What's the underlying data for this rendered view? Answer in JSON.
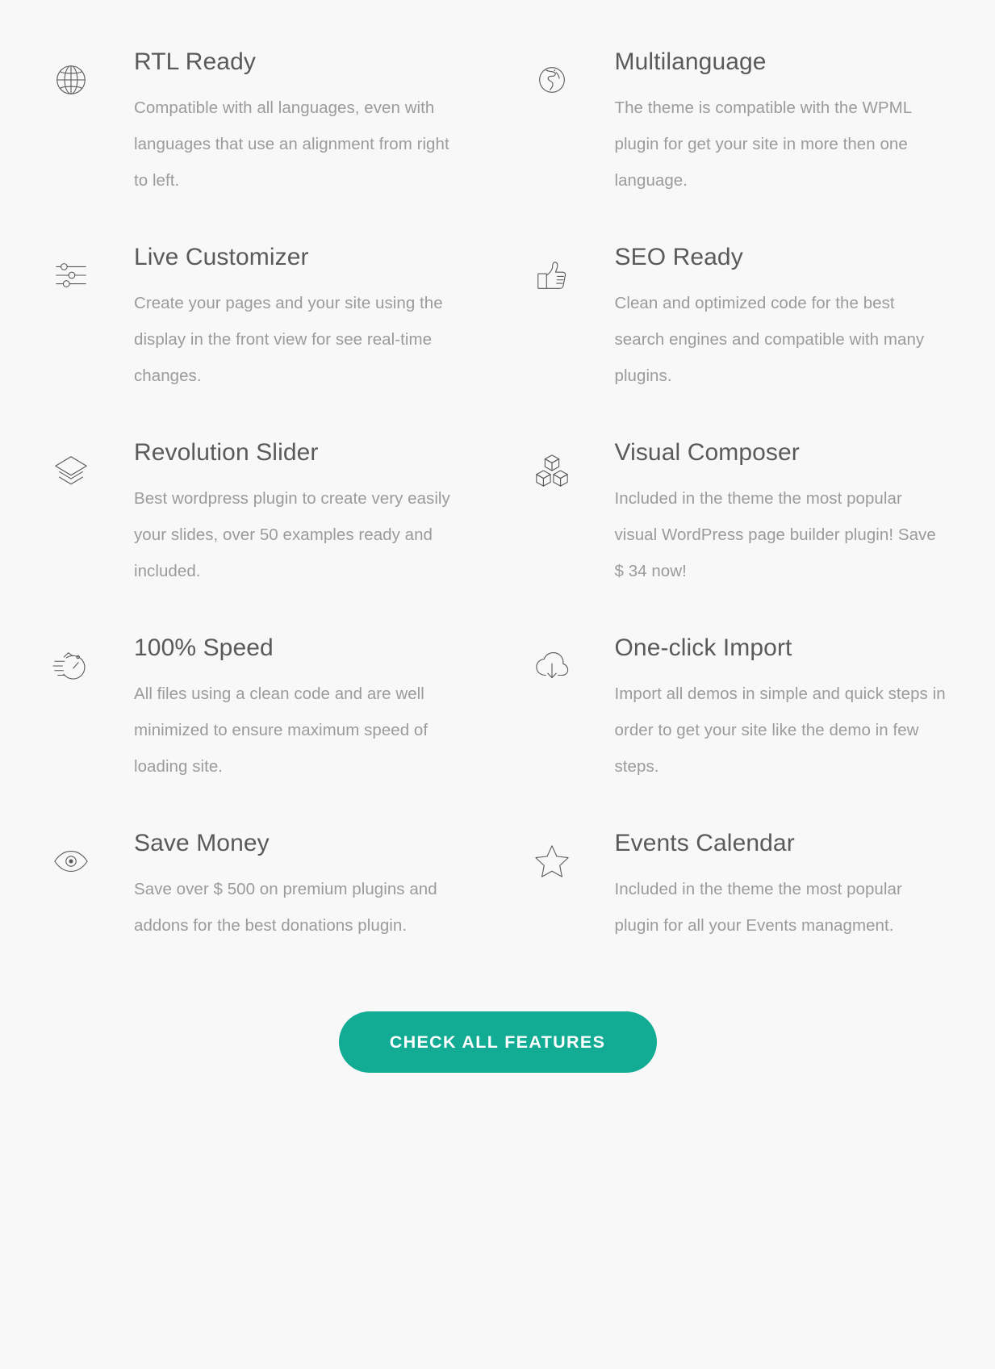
{
  "section": {
    "name": "theme-features",
    "background_color": "#f8f8f8",
    "title_color": "#5a5a5a",
    "desc_color": "#9b9b9b"
  },
  "features": [
    {
      "icon": "globe-grid-icon",
      "title": "RTL Ready",
      "description": "Compatible with all languages, even with languages that use an alignment from right to left."
    },
    {
      "icon": "earth-globe-icon",
      "title": "Multilanguage",
      "description": "The theme is compatible with the WPML plugin for get your site in more then one language."
    },
    {
      "icon": "sliders-icon",
      "title": "Live Customizer",
      "description": "Create your pages and your site using the display in the front view for see real-time changes."
    },
    {
      "icon": "thumbs-up-icon",
      "title": "SEO Ready",
      "description": "Clean and optimized code for the best search engines and compatible with many plugins."
    },
    {
      "icon": "layers-icon",
      "title": "Revolution Slider",
      "description": "Best wordpress plugin to create very easily your slides, over 50 examples ready and included."
    },
    {
      "icon": "cubes-icon",
      "title": "Visual Composer",
      "description": "Included in the theme the most popular visual WordPress page builder plugin! Save $ 34 now!"
    },
    {
      "icon": "stopwatch-icon",
      "title": "100% Speed",
      "description": "All files using a clean code and are well minimized to ensure maximum speed of loading site."
    },
    {
      "icon": "cloud-download-icon",
      "title": "One-click Import",
      "description": "Import all demos in simple and quick steps in order to get your site like the demo in few steps."
    },
    {
      "icon": "eye-icon",
      "title": "Save Money",
      "description": "Save over $ 500 on premium plugins and addons for the best donations plugin."
    },
    {
      "icon": "star-icon",
      "title": "Events Calendar",
      "description": "Included in the theme the most popular plugin for all your Events managment."
    }
  ],
  "cta": {
    "label": "CHECK ALL FEATURES",
    "background_color": "#12ab94",
    "text_color": "#ffffff"
  }
}
